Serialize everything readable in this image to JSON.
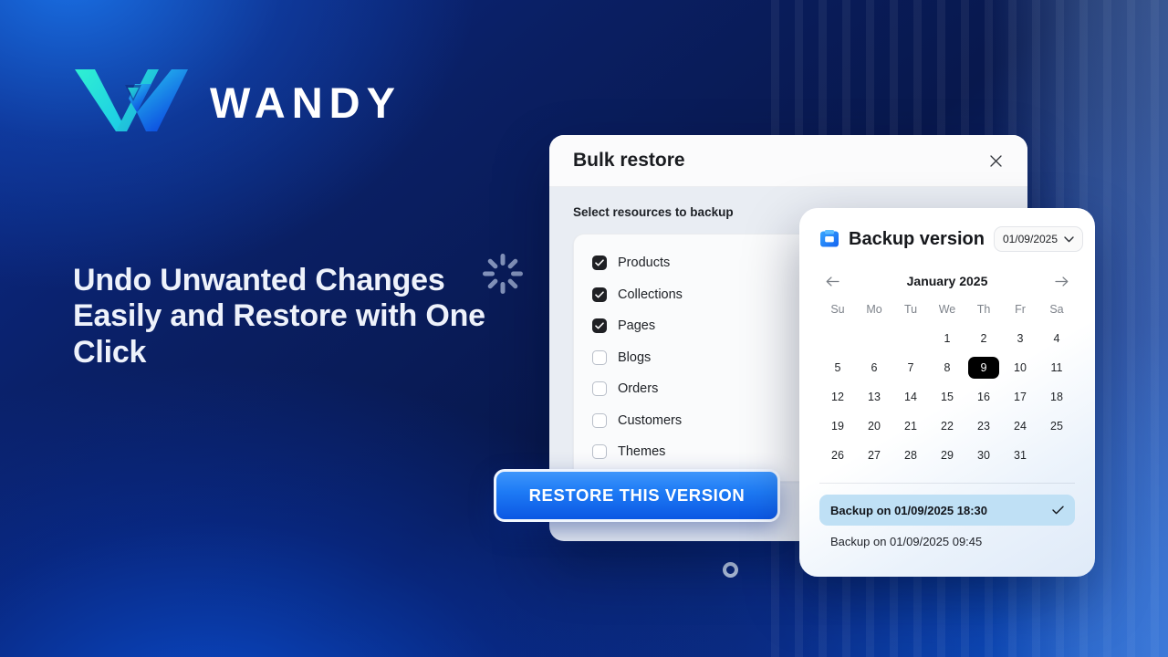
{
  "brand": {
    "name": "WANDY",
    "logo_icon": "wandy-w-logomark",
    "colors": {
      "teal": "#27e0c8",
      "cyan": "#1fc8e8",
      "blue": "#1a66f0",
      "deep_blue": "#0b3fd6"
    }
  },
  "hero": {
    "headline": "Undo Unwanted Changes Easily and Restore with One Click"
  },
  "decorations": {
    "sparkle_icon": "sparkle-burst-icon",
    "ring_icon": "ring-dot-icon"
  },
  "modal": {
    "title": "Bulk restore",
    "close_icon": "close-icon",
    "subtitle": "Select resources to backup",
    "resources": [
      {
        "label": "Products",
        "checked": true
      },
      {
        "label": "Collections",
        "checked": true
      },
      {
        "label": "Pages",
        "checked": true
      },
      {
        "label": "Blogs",
        "checked": false
      },
      {
        "label": "Orders",
        "checked": false
      },
      {
        "label": "Customers",
        "checked": false
      },
      {
        "label": "Themes",
        "checked": false
      }
    ]
  },
  "restore_button": {
    "label": "RESTORE THIS VERSION",
    "accent": "#1e7bf5"
  },
  "backup_panel": {
    "icon": "backup-box-icon",
    "title": "Backup version",
    "version_select": {
      "value": "01/09/2025",
      "chevron_icon": "chevron-down-icon"
    },
    "calendar": {
      "month_label": "January 2025",
      "prev_icon": "arrow-left-icon",
      "next_icon": "arrow-right-icon",
      "weekdays": [
        "Su",
        "Mo",
        "Tu",
        "We",
        "Th",
        "Fr",
        "Sa"
      ],
      "leading_blanks": 3,
      "days": [
        1,
        2,
        3,
        4,
        5,
        6,
        7,
        8,
        9,
        10,
        11,
        12,
        13,
        14,
        15,
        16,
        17,
        18,
        19,
        20,
        21,
        22,
        23,
        24,
        25,
        26,
        27,
        28,
        29,
        30,
        31
      ],
      "selected_day": 9
    },
    "backups": [
      {
        "label": "Backup on 01/09/2025 18:30",
        "selected": true,
        "check_icon": "check-icon"
      },
      {
        "label": "Backup on 01/09/2025 09:45",
        "selected": false
      }
    ]
  }
}
